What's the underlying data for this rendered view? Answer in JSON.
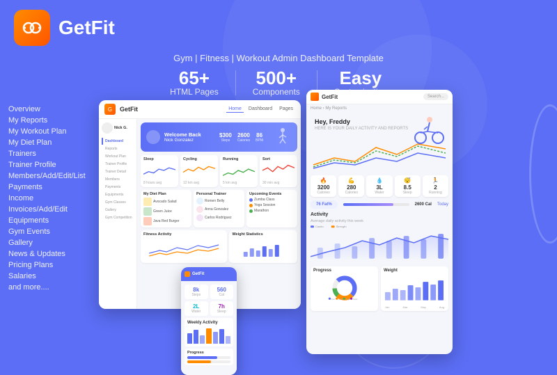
{
  "brand": {
    "name": "GetFit",
    "tagline": "Gym | Fitness | Workout Admin Dashboard Template"
  },
  "stats": [
    {
      "number": "65+",
      "label": "HTML Pages"
    },
    {
      "number": "500+",
      "label": "Components"
    },
    {
      "number": "Easy",
      "label": "Customization"
    }
  ],
  "nav": {
    "items": [
      "Overview",
      "My Reports",
      "My Workout Plan",
      "My Diet Plan",
      "Trainers",
      "Trainer Profile",
      "Members/Add/Edit/List",
      "Payments",
      "Income",
      "Invoices/Add/Edit",
      "Equipments",
      "Gym Events",
      "Gallery",
      "News & Updates",
      "Pricing Plans",
      "Salaries",
      "and more...."
    ]
  },
  "dashboard": {
    "welcome": "Welcome Back",
    "user": "Nick Gonzalez",
    "stats": [
      {
        "num": "$300",
        "lbl": "Steps"
      },
      {
        "num": "2600",
        "lbl": "Calories"
      },
      {
        "num": "86",
        "lbl": "BPM"
      }
    ],
    "mini_charts": [
      "Sleep",
      "Cycling",
      "Running",
      "Sort"
    ],
    "sections": [
      "My Diet Plan",
      "Personal Trainer",
      "Upcoming Events"
    ],
    "fitness": "Fitness Activity",
    "weight": "Weight Statistics"
  },
  "right_dashboard": {
    "greeting": "Hey, Freddy",
    "sub": "HERE IS YOUR DAILY ACTIVITY AND REPORTS",
    "stats": [
      {
        "icon": "🔥",
        "num": "3200",
        "lbl": "Calories"
      },
      {
        "icon": "💪",
        "num": "280",
        "lbl": "Calories"
      },
      {
        "icon": "💧",
        "num": "3L",
        "lbl": "Water"
      },
      {
        "icon": "😴",
        "num": "8.5",
        "lbl": "Sleep"
      },
      {
        "icon": "🏃",
        "num": "2",
        "lbl": "Running"
      }
    ],
    "activity_title": "Activity",
    "progress_title": "Progress",
    "weight_title": "Weight"
  },
  "colors": {
    "primary": "#5b6ef5",
    "orange": "#ff8c00",
    "green": "#4caf50",
    "red": "#f44336",
    "purple": "#9c27b0",
    "teal": "#009688"
  }
}
